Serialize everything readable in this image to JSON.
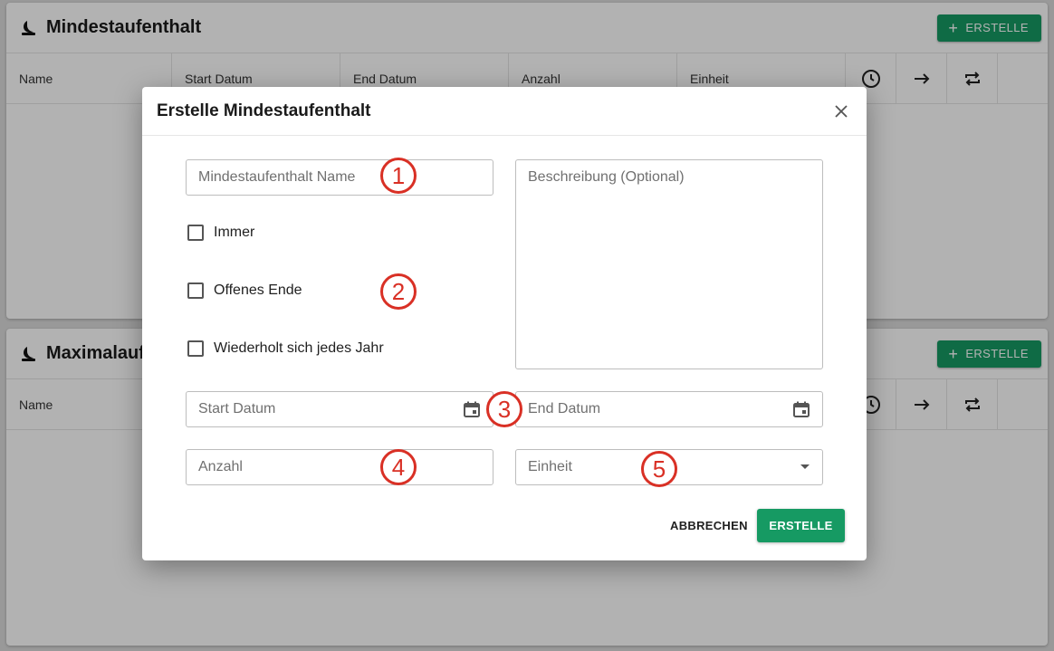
{
  "background": {
    "sections": [
      {
        "title": "Mindestaufenthalt",
        "create_label": "ERSTELLE",
        "columns": [
          "Name",
          "Start Datum",
          "End Datum",
          "Anzahl",
          "Einheit"
        ]
      },
      {
        "title": "Maximalauf",
        "create_label": "ERSTELLE",
        "columns": [
          "Name"
        ]
      }
    ]
  },
  "dialog": {
    "title": "Erstelle Mindestaufenthalt",
    "name_placeholder": "Mindestaufenthalt Name",
    "description_placeholder": "Beschreibung (Optional)",
    "checkboxes": [
      {
        "label": "Immer",
        "checked": false
      },
      {
        "label": "Offenes Ende",
        "checked": false
      },
      {
        "label": "Wiederholt sich jedes Jahr",
        "checked": false
      }
    ],
    "start_date_placeholder": "Start Datum",
    "end_date_placeholder": "End Datum",
    "count_placeholder": "Anzahl",
    "unit_placeholder": "Einheit",
    "cancel_label": "ABBRECHEN",
    "submit_label": "ERSTELLE"
  },
  "markers": [
    "1",
    "2",
    "3",
    "4",
    "5"
  ],
  "colors": {
    "accent": "#169a63",
    "marker": "#d93025",
    "overlay": "rgba(0,0,0,0.30)"
  },
  "icons": {
    "section": "sleep-moon-icon",
    "table_actions": [
      "clock-icon",
      "arrow-right-icon",
      "repeat-icon"
    ],
    "dialog_close": "close-icon",
    "date": "calendar-icon",
    "select": "dropdown-arrow-icon"
  }
}
